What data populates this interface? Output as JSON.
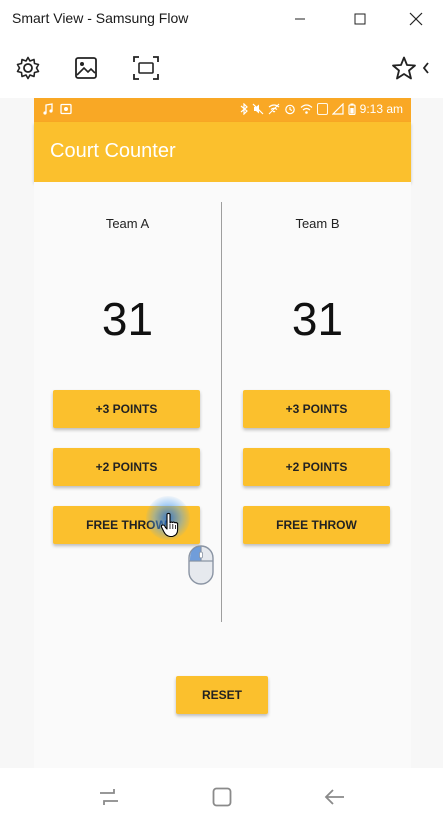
{
  "window": {
    "title": "Smart View - Samsung Flow"
  },
  "toolbar": {
    "icons": [
      "gear-icon",
      "gallery-icon",
      "screen-capture-icon",
      "star-icon",
      "chevron-left-icon"
    ]
  },
  "statusbar": {
    "time": "9:13 am"
  },
  "app": {
    "title": "Court Counter",
    "accent": "#fbc02d",
    "status_color": "#f9a825"
  },
  "teams": [
    {
      "name": "Team A",
      "score": "31",
      "buttons": {
        "plus3": "+3 POINTS",
        "plus2": "+2 POINTS",
        "free_throw": "FREE THROW"
      }
    },
    {
      "name": "Team B",
      "score": "31",
      "buttons": {
        "plus3": "+3 POINTS",
        "plus2": "+2 POINTS",
        "free_throw": "FREE THROW"
      }
    }
  ],
  "reset_label": "RESET",
  "navbar": {
    "icons": [
      "recent-apps-icon",
      "home-icon",
      "back-icon"
    ]
  }
}
